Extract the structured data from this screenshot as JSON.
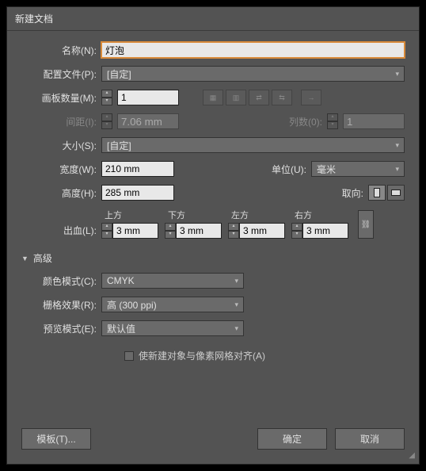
{
  "dialog": {
    "title": "新建文档"
  },
  "name": {
    "label": "名称(N):",
    "value": "灯泡"
  },
  "profile": {
    "label": "配置文件(P):",
    "value": "[自定]"
  },
  "artboards": {
    "label": "画板数量(M):",
    "value": "1"
  },
  "spacing": {
    "label": "间距(I):",
    "value": "7.06 mm"
  },
  "columns": {
    "label": "列数(0):",
    "value": "1"
  },
  "size": {
    "label": "大小(S):",
    "value": "[自定]"
  },
  "width": {
    "label": "宽度(W):",
    "value": "210 mm"
  },
  "height": {
    "label": "高度(H):",
    "value": "285 mm"
  },
  "units": {
    "label": "单位(U):",
    "value": "毫米"
  },
  "orientation": {
    "label": "取向:"
  },
  "bleed": {
    "label": "出血(L):",
    "top": {
      "label": "上方",
      "value": "3 mm"
    },
    "bottom": {
      "label": "下方",
      "value": "3 mm"
    },
    "left": {
      "label": "左方",
      "value": "3 mm"
    },
    "right": {
      "label": "右方",
      "value": "3 mm"
    }
  },
  "advanced": {
    "label": "高级"
  },
  "colorMode": {
    "label": "颜色模式(C):",
    "value": "CMYK"
  },
  "raster": {
    "label": "栅格效果(R):",
    "value": "高 (300 ppi)"
  },
  "preview": {
    "label": "预览模式(E):",
    "value": "默认值"
  },
  "alignGrid": {
    "label": "使新建对象与像素网格对齐(A)"
  },
  "buttons": {
    "template": "模板(T)...",
    "ok": "确定",
    "cancel": "取消"
  }
}
